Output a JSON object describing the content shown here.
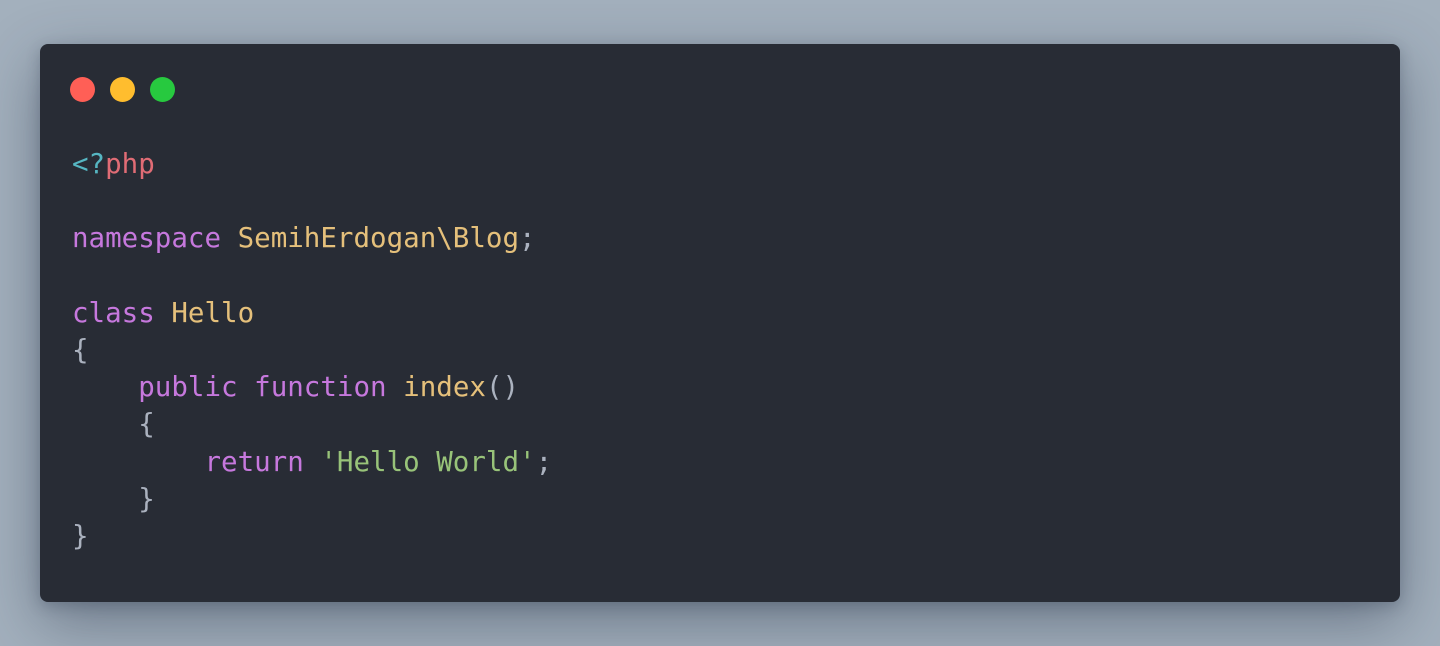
{
  "window": {
    "controls": {
      "close_color": "#ff5f56",
      "minimize_color": "#ffbd2e",
      "zoom_color": "#27c93f"
    }
  },
  "theme": {
    "punctuation": "#abb2bf",
    "keyword": "#c678dd",
    "type": "#e5c07b",
    "string": "#98c379",
    "tag": "#56b6c2",
    "tag_name": "#e06c75"
  },
  "code": {
    "language": "php",
    "lines": [
      [
        {
          "text": "<?",
          "kind": "tag"
        },
        {
          "text": "php",
          "kind": "tag_name"
        }
      ],
      [],
      [
        {
          "text": "namespace",
          "kind": "keyword"
        },
        {
          "text": " ",
          "kind": "punctuation"
        },
        {
          "text": "SemihErdogan\\Blog",
          "kind": "type"
        },
        {
          "text": ";",
          "kind": "punctuation"
        }
      ],
      [],
      [
        {
          "text": "class",
          "kind": "keyword"
        },
        {
          "text": " ",
          "kind": "punctuation"
        },
        {
          "text": "Hello",
          "kind": "type"
        }
      ],
      [
        {
          "text": "{",
          "kind": "punctuation"
        }
      ],
      [
        {
          "text": "    ",
          "kind": "punctuation"
        },
        {
          "text": "public",
          "kind": "keyword"
        },
        {
          "text": " ",
          "kind": "punctuation"
        },
        {
          "text": "function",
          "kind": "keyword"
        },
        {
          "text": " ",
          "kind": "punctuation"
        },
        {
          "text": "index",
          "kind": "type"
        },
        {
          "text": "()",
          "kind": "punctuation"
        }
      ],
      [
        {
          "text": "    {",
          "kind": "punctuation"
        }
      ],
      [
        {
          "text": "        ",
          "kind": "punctuation"
        },
        {
          "text": "return",
          "kind": "keyword"
        },
        {
          "text": " ",
          "kind": "punctuation"
        },
        {
          "text": "'Hello World'",
          "kind": "string"
        },
        {
          "text": ";",
          "kind": "punctuation"
        }
      ],
      [
        {
          "text": "    }",
          "kind": "punctuation"
        }
      ],
      [
        {
          "text": "}",
          "kind": "punctuation"
        }
      ]
    ]
  }
}
